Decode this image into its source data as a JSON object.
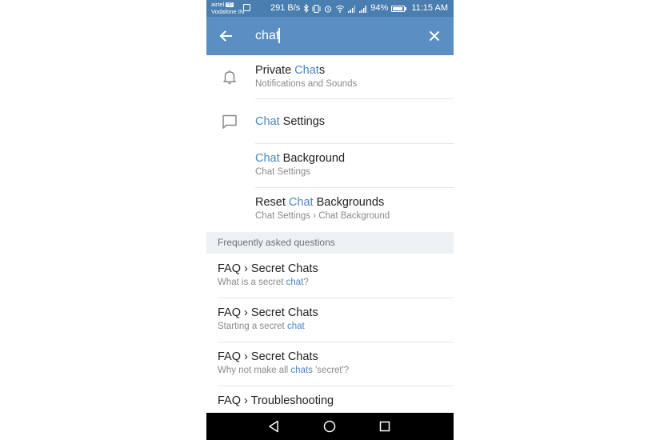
{
  "status_bar": {
    "carrier_top": "airtel",
    "carrier_badge": "HD",
    "carrier_bottom": "Vodafone IN",
    "net_speed": "291 B/s",
    "battery": "94%",
    "time": "11:15 AM"
  },
  "search": {
    "value": "chat"
  },
  "results": [
    {
      "icon": "bell-icon",
      "title_before": "Private ",
      "title_match": "Chat",
      "title_after": "s",
      "subtitle": "Notifications and Sounds"
    },
    {
      "icon": "chat-bubble-icon",
      "title_before": "",
      "title_match": "Chat",
      "title_after": " Settings"
    },
    {
      "title_before": "",
      "title_match": "Chat",
      "title_after": " Background",
      "subtitle": "Chat Settings"
    },
    {
      "title_before": "Reset ",
      "title_match": "Chat",
      "title_after": " Backgrounds",
      "subtitle": "Chat Settings › Chat Background"
    }
  ],
  "faq_header": "Frequently asked questions",
  "faq": [
    {
      "title": "FAQ › Secret Chats",
      "sub_before": "What is a secret ",
      "sub_match": "chat",
      "sub_after": "?"
    },
    {
      "title": "FAQ › Secret Chats",
      "sub_before": "Starting a secret ",
      "sub_match": "chat",
      "sub_after": ""
    },
    {
      "title": "FAQ › Secret Chats",
      "sub_before": "Why not make all ",
      "sub_match": "chats",
      "sub_after": " 'secret'?"
    },
    {
      "title": "FAQ › Troubleshooting"
    }
  ],
  "colors": {
    "toolbar": "#5b8fc4",
    "status_bar": "#4a7eb0",
    "highlight": "#4a86c5"
  }
}
